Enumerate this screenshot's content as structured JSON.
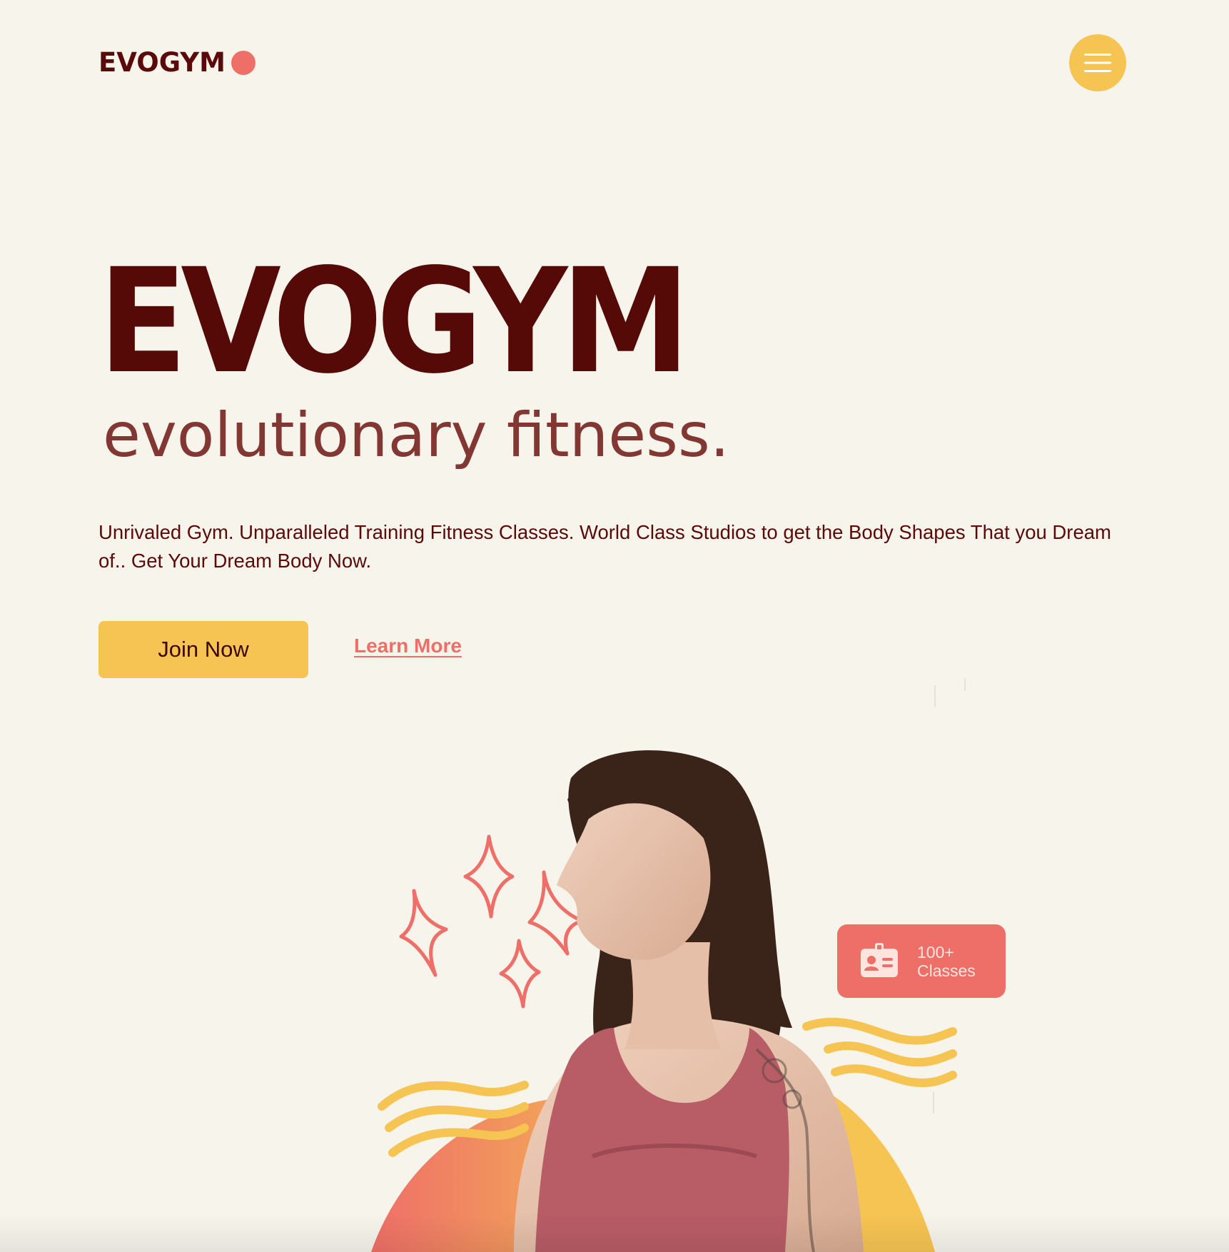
{
  "nav": {
    "logo_text": "EVOGYM",
    "menu_icon": "hamburger-menu-icon"
  },
  "hero": {
    "title": "EVOGYM",
    "subtitle": "evolutionary fitness.",
    "description": "Unrivaled Gym. Unparalleled Training Fitness Classes. World Class Studios to get the Body Shapes That you Dream of.. Get Your Dream Body Now.",
    "join_label": "Join Now",
    "learn_label": "Learn More"
  },
  "badge": {
    "icon": "id-card-icon",
    "count": "100+",
    "label": "Classes"
  },
  "colors": {
    "background": "#f7f4ec",
    "primary_dark": "#560a07",
    "accent_yellow": "#f6c453",
    "accent_coral": "#ee6f68"
  }
}
